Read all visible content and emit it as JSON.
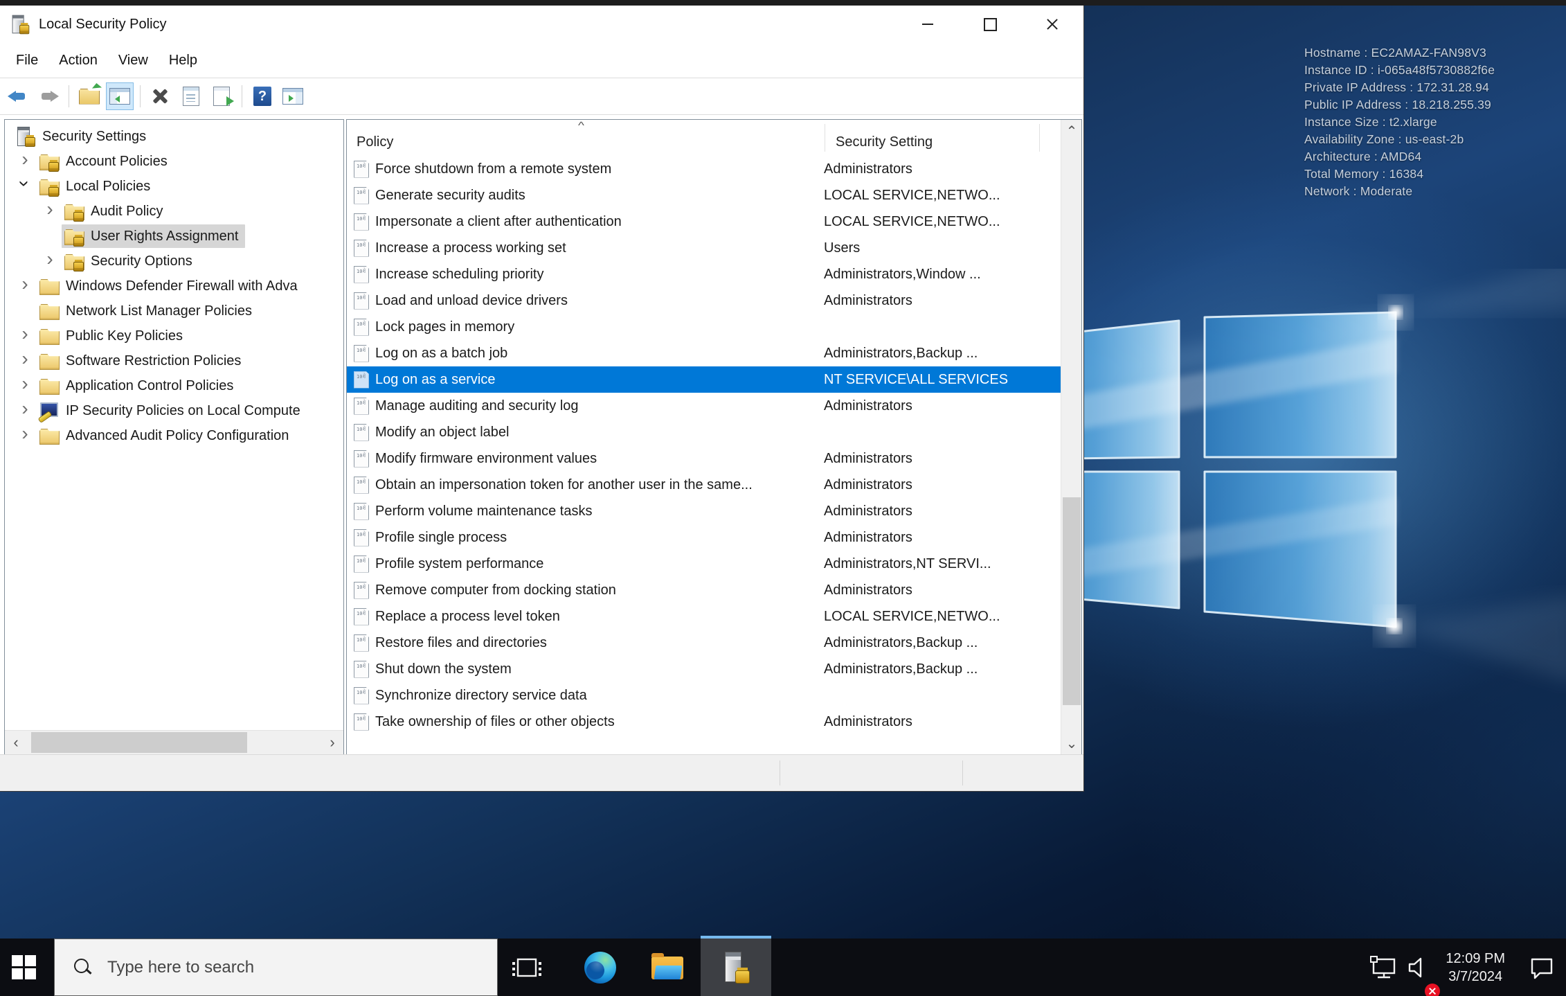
{
  "window": {
    "title": "Local Security Policy",
    "menu": [
      {
        "label": "File"
      },
      {
        "label": "Action"
      },
      {
        "label": "View"
      },
      {
        "label": "Help"
      }
    ],
    "toolbar": [
      {
        "name": "back",
        "data_name": "back-icon"
      },
      {
        "name": "forward",
        "data_name": "forward-icon"
      },
      {
        "name": "separator",
        "data_name": "toolbar-separator"
      },
      {
        "name": "up-level",
        "data_name": "up-one-level-icon"
      },
      {
        "name": "show-tree",
        "data_name": "show-console-tree-icon",
        "active": true
      },
      {
        "name": "separator",
        "data_name": "toolbar-separator"
      },
      {
        "name": "delete",
        "data_name": "delete-icon"
      },
      {
        "name": "properties",
        "data_name": "properties-icon"
      },
      {
        "name": "export-list",
        "data_name": "export-list-icon"
      },
      {
        "name": "separator",
        "data_name": "toolbar-separator"
      },
      {
        "name": "help",
        "data_name": "help-icon"
      },
      {
        "name": "action-pane",
        "data_name": "show-action-pane-icon"
      }
    ]
  },
  "tree": {
    "items": [
      {
        "label": "Security Settings",
        "level": 0,
        "expander": "absent",
        "icon": "server-lock",
        "selected": false
      },
      {
        "label": "Account Policies",
        "level": 1,
        "expander": "collapsed",
        "icon": "folder-lock",
        "selected": false
      },
      {
        "label": "Local Policies",
        "level": 1,
        "expander": "expanded",
        "icon": "folder-lock",
        "selected": false
      },
      {
        "label": "Audit Policy",
        "level": 2,
        "expander": "collapsed",
        "icon": "folder-lock",
        "selected": false
      },
      {
        "label": "User Rights Assignment",
        "level": 2,
        "expander": "blank",
        "icon": "folder-lock",
        "selected": true
      },
      {
        "label": "Security Options",
        "level": 2,
        "expander": "collapsed",
        "icon": "folder-lock",
        "selected": false
      },
      {
        "label": "Windows Defender Firewall with Adva",
        "level": 1,
        "expander": "collapsed",
        "icon": "folder",
        "selected": false
      },
      {
        "label": "Network List Manager Policies",
        "level": 1,
        "expander": "blank",
        "icon": "folder",
        "selected": false
      },
      {
        "label": "Public Key Policies",
        "level": 1,
        "expander": "collapsed",
        "icon": "folder",
        "selected": false
      },
      {
        "label": "Software Restriction Policies",
        "level": 1,
        "expander": "collapsed",
        "icon": "folder",
        "selected": false
      },
      {
        "label": "Application Control Policies",
        "level": 1,
        "expander": "collapsed",
        "icon": "folder",
        "selected": false
      },
      {
        "label": "IP Security Policies on Local Compute",
        "level": 1,
        "expander": "collapsed",
        "icon": "computer-key",
        "selected": false
      },
      {
        "label": "Advanced Audit Policy Configuration",
        "level": 1,
        "expander": "collapsed",
        "icon": "folder",
        "selected": false
      }
    ]
  },
  "list": {
    "columns": [
      {
        "label": "Policy"
      },
      {
        "label": "Security Setting"
      }
    ],
    "sort_caret": "^",
    "rows": [
      {
        "policy": "Force shutdown from a remote system",
        "setting": "Administrators",
        "selected": false
      },
      {
        "policy": "Generate security audits",
        "setting": "LOCAL SERVICE,NETWO...",
        "selected": false
      },
      {
        "policy": "Impersonate a client after authentication",
        "setting": "LOCAL SERVICE,NETWO...",
        "selected": false
      },
      {
        "policy": "Increase a process working set",
        "setting": "Users",
        "selected": false
      },
      {
        "policy": "Increase scheduling priority",
        "setting": "Administrators,Window ...",
        "selected": false
      },
      {
        "policy": "Load and unload device drivers",
        "setting": "Administrators",
        "selected": false
      },
      {
        "policy": "Lock pages in memory",
        "setting": "",
        "selected": false
      },
      {
        "policy": "Log on as a batch job",
        "setting": "Administrators,Backup ...",
        "selected": false
      },
      {
        "policy": "Log on as a service",
        "setting": "NT SERVICE\\ALL SERVICES",
        "selected": true
      },
      {
        "policy": "Manage auditing and security log",
        "setting": "Administrators",
        "selected": false
      },
      {
        "policy": "Modify an object label",
        "setting": "",
        "selected": false
      },
      {
        "policy": "Modify firmware environment values",
        "setting": "Administrators",
        "selected": false
      },
      {
        "policy": "Obtain an impersonation token for another user in the same...",
        "setting": "Administrators",
        "selected": false
      },
      {
        "policy": "Perform volume maintenance tasks",
        "setting": "Administrators",
        "selected": false
      },
      {
        "policy": "Profile single process",
        "setting": "Administrators",
        "selected": false
      },
      {
        "policy": "Profile system performance",
        "setting": "Administrators,NT SERVI...",
        "selected": false
      },
      {
        "policy": "Remove computer from docking station",
        "setting": "Administrators",
        "selected": false
      },
      {
        "policy": "Replace a process level token",
        "setting": "LOCAL SERVICE,NETWO...",
        "selected": false
      },
      {
        "policy": "Restore files and directories",
        "setting": "Administrators,Backup ...",
        "selected": false
      },
      {
        "policy": "Shut down the system",
        "setting": "Administrators,Backup ...",
        "selected": false
      },
      {
        "policy": "Synchronize directory service data",
        "setting": "",
        "selected": false
      },
      {
        "policy": "Take ownership of files or other objects",
        "setting": "Administrators",
        "selected": false
      }
    ]
  },
  "desktop": {
    "info_lines": [
      "Hostname : EC2AMAZ-FAN98V3",
      "Instance ID : i-065a48f5730882f6e",
      "Private IP Address : 172.31.28.94",
      "Public IP Address : 18.218.255.39",
      "Instance Size : t2.xlarge",
      "Availability Zone : us-east-2b",
      "Architecture : AMD64",
      "Total Memory : 16384",
      "Network : Moderate"
    ]
  },
  "taskbar": {
    "search_placeholder": "Type here to search",
    "time": "12:09 PM",
    "date": "3/7/2024"
  },
  "colors": {
    "selection_blue": "#0078d7",
    "taskbar_underline": "#76b9ed",
    "desktop_navy": "#123158"
  }
}
